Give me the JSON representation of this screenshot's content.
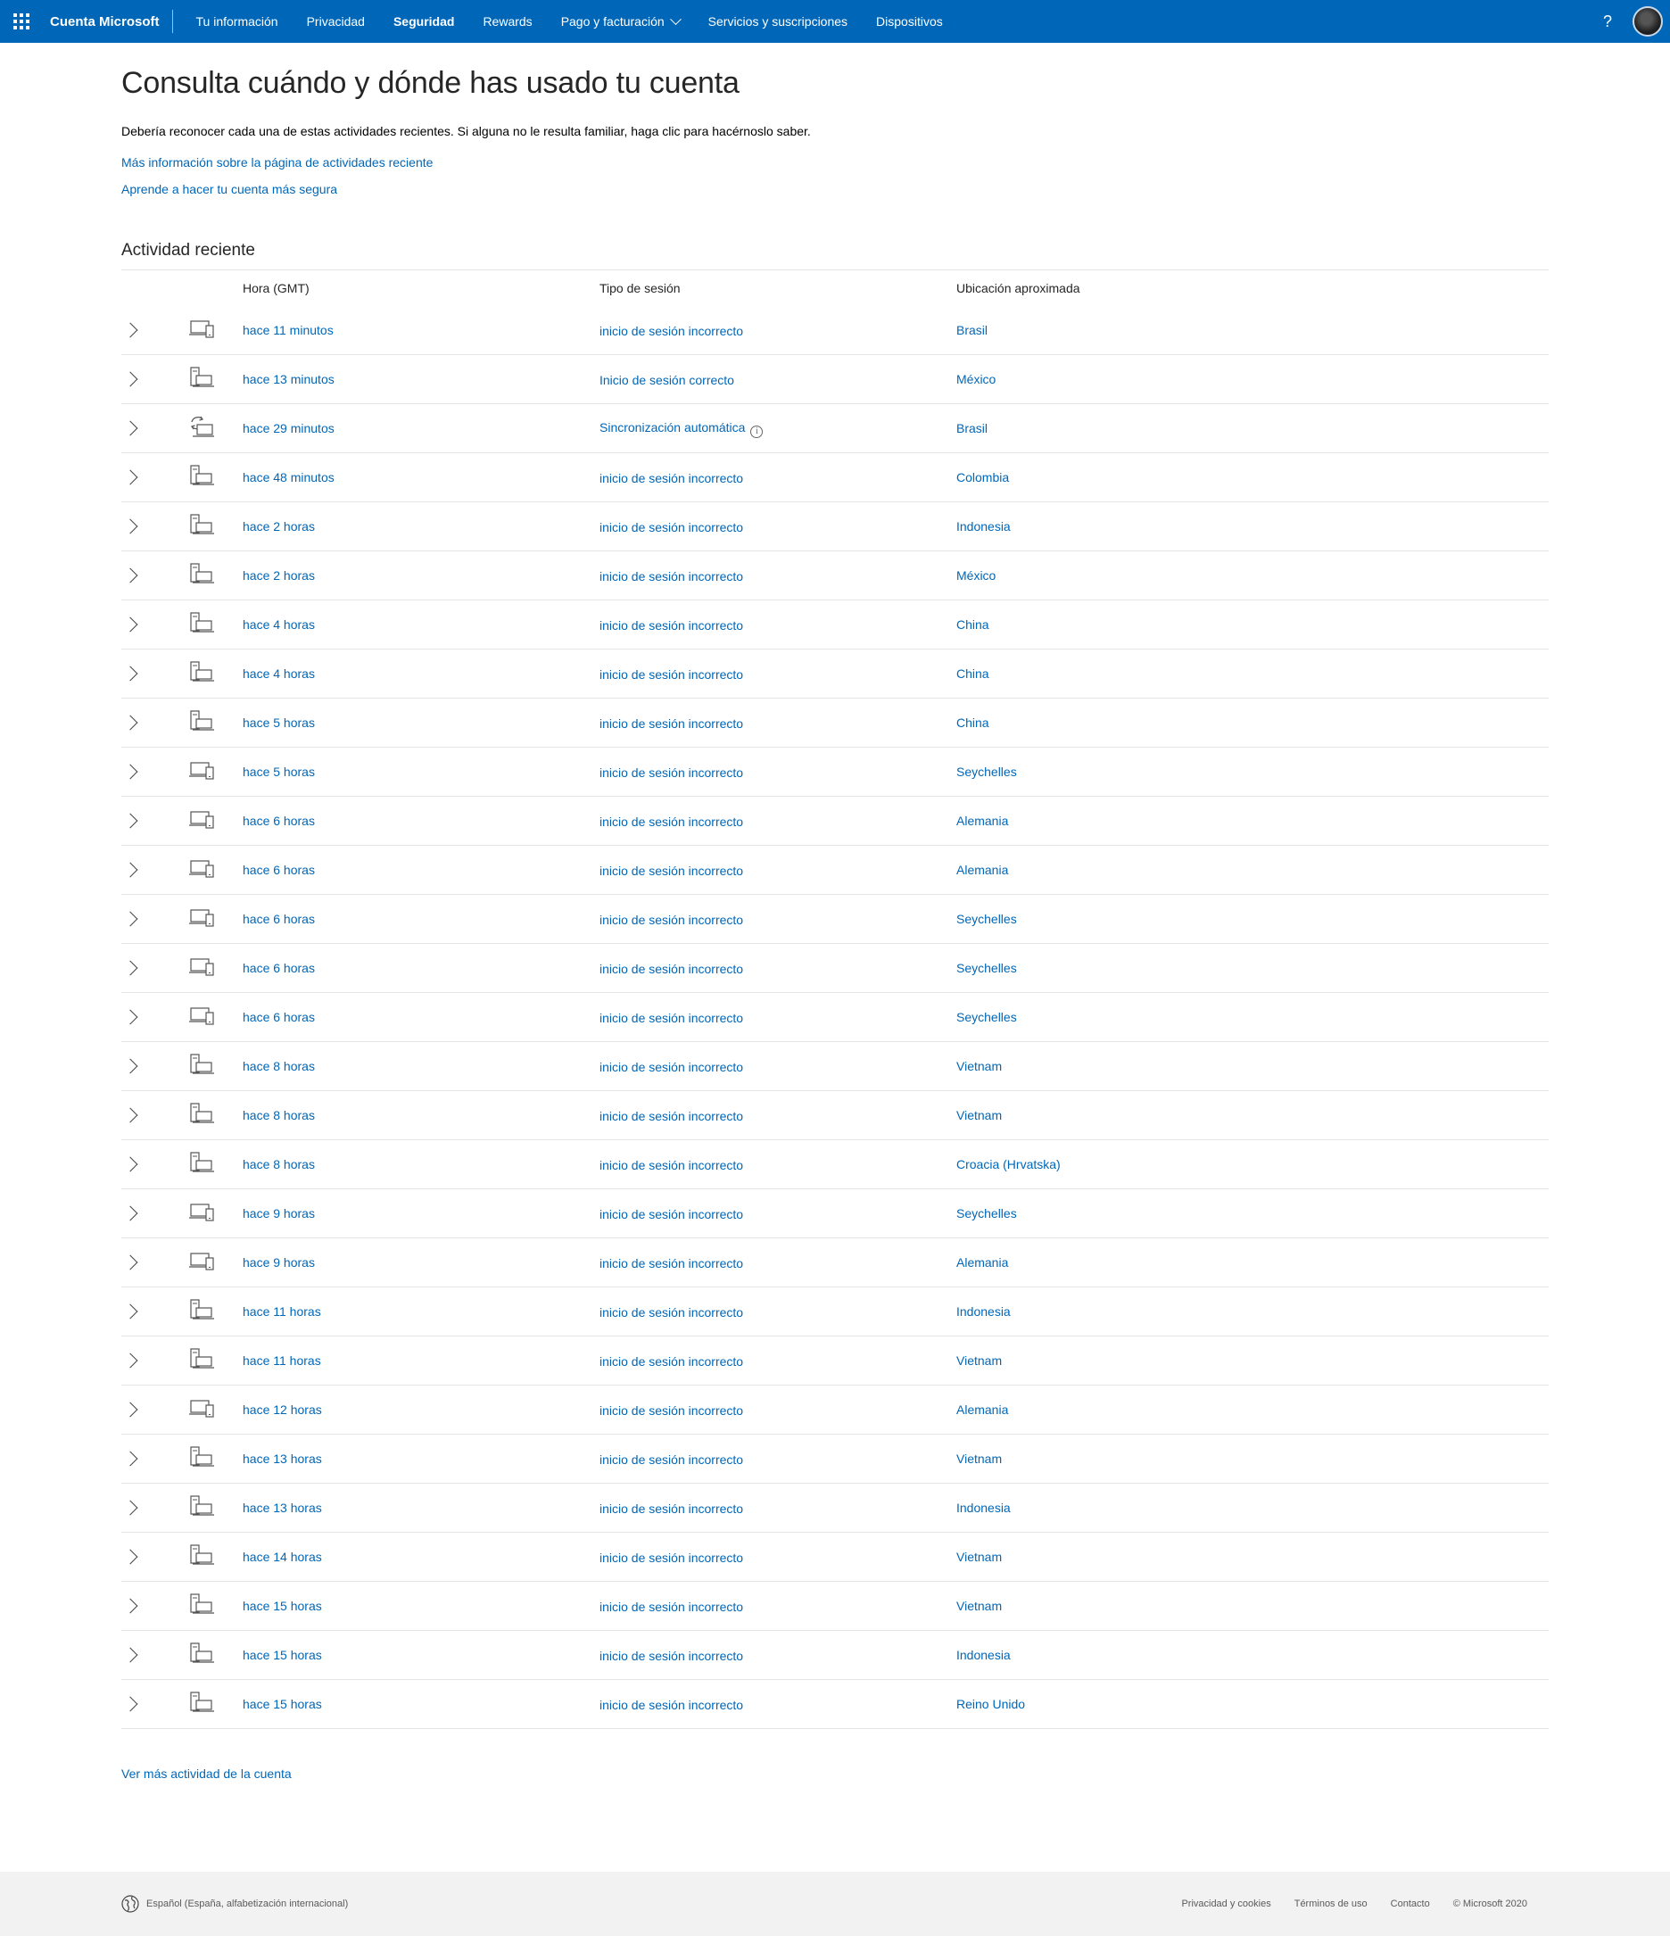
{
  "topbar": {
    "brand": "Cuenta Microsoft",
    "nav": [
      {
        "label": "Tu información",
        "active": false
      },
      {
        "label": "Privacidad",
        "active": false
      },
      {
        "label": "Seguridad",
        "active": true
      },
      {
        "label": "Rewards",
        "active": false
      },
      {
        "label": "Pago y facturación",
        "active": false,
        "dropdown": true
      },
      {
        "label": "Servicios y suscripciones",
        "active": false
      },
      {
        "label": "Dispositivos",
        "active": false
      }
    ],
    "help": "?",
    "color": "#0067b8"
  },
  "main": {
    "title": "Consulta cuándo y dónde has usado tu cuenta",
    "intro": "Debería reconocer cada una de estas actividades recientes. Si alguna no le resulta familiar, haga clic para hacérnoslo saber.",
    "link1": "Más información sobre la página de actividades reciente",
    "link2": "Aprende a hacer tu cuenta más segura",
    "section_title": "Actividad reciente",
    "headers": {
      "time": "Hora (GMT)",
      "type": "Tipo de sesión",
      "location": "Ubicación aproximada"
    },
    "rows": [
      {
        "time": "hace 11 minutos",
        "type": "inicio de sesión incorrecto",
        "location": "Brasil",
        "icon": "device-laptop-phone-icon"
      },
      {
        "time": "hace 13 minutos",
        "type": "Inicio de sesión correcto",
        "location": "México",
        "icon": "device-desktop-laptop-icon"
      },
      {
        "time": "hace 29 minutos",
        "type": "Sincronización automática",
        "location": "Brasil",
        "icon": "device-sync-icon",
        "info": true
      },
      {
        "time": "hace 48 minutos",
        "type": "inicio de sesión incorrecto",
        "location": "Colombia",
        "icon": "device-desktop-laptop-icon"
      },
      {
        "time": "hace 2 horas",
        "type": "inicio de sesión incorrecto",
        "location": "Indonesia",
        "icon": "device-desktop-laptop-icon"
      },
      {
        "time": "hace 2 horas",
        "type": "inicio de sesión incorrecto",
        "location": "México",
        "icon": "device-desktop-laptop-icon"
      },
      {
        "time": "hace 4 horas",
        "type": "inicio de sesión incorrecto",
        "location": "China",
        "icon": "device-desktop-laptop-icon"
      },
      {
        "time": "hace 4 horas",
        "type": "inicio de sesión incorrecto",
        "location": "China",
        "icon": "device-desktop-laptop-icon"
      },
      {
        "time": "hace 5 horas",
        "type": "inicio de sesión incorrecto",
        "location": "China",
        "icon": "device-desktop-laptop-icon"
      },
      {
        "time": "hace 5 horas",
        "type": "inicio de sesión incorrecto",
        "location": "Seychelles",
        "icon": "device-laptop-phone-icon"
      },
      {
        "time": "hace 6 horas",
        "type": "inicio de sesión incorrecto",
        "location": "Alemania",
        "icon": "device-laptop-phone-icon"
      },
      {
        "time": "hace 6 horas",
        "type": "inicio de sesión incorrecto",
        "location": "Alemania",
        "icon": "device-laptop-phone-icon"
      },
      {
        "time": "hace 6 horas",
        "type": "inicio de sesión incorrecto",
        "location": "Seychelles",
        "icon": "device-laptop-phone-icon"
      },
      {
        "time": "hace 6 horas",
        "type": "inicio de sesión incorrecto",
        "location": "Seychelles",
        "icon": "device-laptop-phone-icon"
      },
      {
        "time": "hace 6 horas",
        "type": "inicio de sesión incorrecto",
        "location": "Seychelles",
        "icon": "device-laptop-phone-icon"
      },
      {
        "time": "hace 8 horas",
        "type": "inicio de sesión incorrecto",
        "location": "Vietnam",
        "icon": "device-desktop-laptop-icon"
      },
      {
        "time": "hace 8 horas",
        "type": "inicio de sesión incorrecto",
        "location": "Vietnam",
        "icon": "device-desktop-laptop-icon"
      },
      {
        "time": "hace 8 horas",
        "type": "inicio de sesión incorrecto",
        "location": "Croacia (Hrvatska)",
        "icon": "device-desktop-laptop-icon"
      },
      {
        "time": "hace 9 horas",
        "type": "inicio de sesión incorrecto",
        "location": "Seychelles",
        "icon": "device-laptop-phone-icon"
      },
      {
        "time": "hace 9 horas",
        "type": "inicio de sesión incorrecto",
        "location": "Alemania",
        "icon": "device-laptop-phone-icon"
      },
      {
        "time": "hace 11 horas",
        "type": "inicio de sesión incorrecto",
        "location": "Indonesia",
        "icon": "device-desktop-laptop-icon"
      },
      {
        "time": "hace 11 horas",
        "type": "inicio de sesión incorrecto",
        "location": "Vietnam",
        "icon": "device-desktop-laptop-icon"
      },
      {
        "time": "hace 12 horas",
        "type": "inicio de sesión incorrecto",
        "location": "Alemania",
        "icon": "device-laptop-phone-icon"
      },
      {
        "time": "hace 13 horas",
        "type": "inicio de sesión incorrecto",
        "location": "Vietnam",
        "icon": "device-desktop-laptop-icon"
      },
      {
        "time": "hace 13 horas",
        "type": "inicio de sesión incorrecto",
        "location": "Indonesia",
        "icon": "device-desktop-laptop-icon"
      },
      {
        "time": "hace 14 horas",
        "type": "inicio de sesión incorrecto",
        "location": "Vietnam",
        "icon": "device-desktop-laptop-icon"
      },
      {
        "time": "hace 15 horas",
        "type": "inicio de sesión incorrecto",
        "location": "Vietnam",
        "icon": "device-desktop-laptop-icon"
      },
      {
        "time": "hace 15 horas",
        "type": "inicio de sesión incorrecto",
        "location": "Indonesia",
        "icon": "device-desktop-laptop-icon"
      },
      {
        "time": "hace 15 horas",
        "type": "inicio de sesión incorrecto",
        "location": "Reino Unido",
        "icon": "device-desktop-laptop-icon"
      }
    ],
    "more_link": "Ver más actividad de la cuenta"
  },
  "footer": {
    "language": "Español (España, alfabetización internacional)",
    "links": [
      "Privacidad y cookies",
      "Términos de uso",
      "Contacto"
    ],
    "copyright": "© Microsoft 2020"
  }
}
